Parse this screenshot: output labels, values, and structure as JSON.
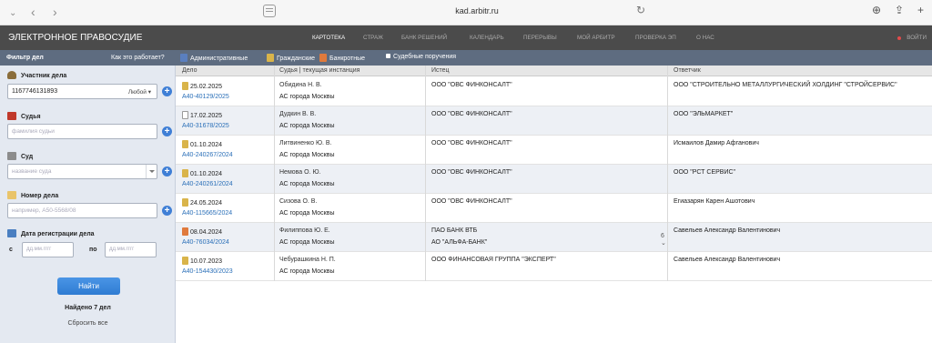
{
  "browser": {
    "url": "kad.arbitr.ru",
    "back_icon": "chevron-left-icon",
    "forward_icon": "chevron-right-icon"
  },
  "header": {
    "logo": "ЭЛЕКТРОННОЕ ПРАВОСУДИЕ",
    "nav": [
      {
        "label": "КАРТОТЕКА"
      },
      {
        "label": "СТРАЖ"
      },
      {
        "label": "БАНК РЕШЕНИЙ"
      },
      {
        "label": "КАЛЕНДАРЬ"
      },
      {
        "label": "ПЕРЕРЫВЫ"
      },
      {
        "label": "МОЙ АРБИТР"
      },
      {
        "label": "ПРОВЕРКА ЭП"
      },
      {
        "label": "О НАС"
      }
    ],
    "login": "ВОЙТИ"
  },
  "subheader": {
    "filter_title": "Фильтр дел",
    "how_it_works": "Как это работает?",
    "categories": [
      {
        "label": "Административные",
        "color": "#5a7fbf"
      },
      {
        "label": "Гражданские",
        "color": "#d9b44a"
      },
      {
        "label": "Банкротные",
        "color": "#e07a3c"
      },
      {
        "label": "Судебные поручения",
        "color": "#ffffff"
      }
    ]
  },
  "sidebar": {
    "participant_label": "Участник дела",
    "participant_value": "1167746131893",
    "participant_role": "Любой",
    "judge_label": "Судья",
    "judge_placeholder": "фамилия судьи",
    "court_label": "Суд",
    "court_placeholder": "название суда",
    "case_label": "Номер дела",
    "case_placeholder": "например, А50-5568/08",
    "date_label": "Дата регистрации дела",
    "date_from": "с",
    "date_to": "по",
    "date_placeholder": "дд.мм.гггг",
    "find_button": "Найти",
    "found_text": "Найдено 7 дел",
    "reset_text": "Сбросить все"
  },
  "table": {
    "headers": {
      "case": "Дело",
      "judge": "Судья | текущая инстанция",
      "plaintiff": "Истец",
      "respondent": "Ответчик"
    },
    "rows": [
      {
        "date": "25.02.2025",
        "number": "А40-40129/2025",
        "judge": "Обидина Н. В.",
        "court": "АС города Москвы",
        "plaintiff": "ООО \"ОВС ФИНКОНСАЛТ\"",
        "plaintiff2": "",
        "respondent": "ООО \"СТРОИТЕЛЬНО МЕТАЛЛУРГИЧЕСКИЙ ХОЛДИНГ \"СТРОЙСЕРВИС\"",
        "icon_color": "#d9b44a"
      },
      {
        "date": "17.02.2025",
        "number": "А40-31678/2025",
        "judge": "Дудкин В. В.",
        "court": "АС города Москвы",
        "plaintiff": "ООО \"ОВС ФИНКОНСАЛТ\"",
        "plaintiff2": "",
        "respondent": "ООО \"ЭЛЬМАРКЕТ\"",
        "icon_color": "#ffffff"
      },
      {
        "date": "01.10.2024",
        "number": "А40-240267/2024",
        "judge": "Литвиненко Ю. В.",
        "court": "АС города Москвы",
        "plaintiff": "ООО \"ОВС ФИНКОНСАЛТ\"",
        "plaintiff2": "",
        "respondent": "Исмаилов Дамир Афганович",
        "icon_color": "#d9b44a"
      },
      {
        "date": "01.10.2024",
        "number": "А40-240261/2024",
        "judge": "Немова О. Ю.",
        "court": "АС города Москвы",
        "plaintiff": "ООО \"ОВС ФИНКОНСАЛТ\"",
        "plaintiff2": "",
        "respondent": "ООО \"РСТ СЕРВИС\"",
        "icon_color": "#d9b44a"
      },
      {
        "date": "24.05.2024",
        "number": "А40-115665/2024",
        "judge": "Сизова О. В.",
        "court": "АС города Москвы",
        "plaintiff": "ООО \"ОВС ФИНКОНСАЛТ\"",
        "plaintiff2": "",
        "respondent": "Егиазарян Карен Ашотович",
        "icon_color": "#d9b44a"
      },
      {
        "date": "08.04.2024",
        "number": "А40-76034/2024",
        "judge": "Филиппова Ю. Е.",
        "court": "АС города Москвы",
        "plaintiff": "ПАО БАНК ВТБ",
        "plaintiff2": "АО \"АЛЬФА-БАНК\"",
        "respondent": "Савельев Александр Валентинович",
        "icon_color": "#e07a3c",
        "badge": "6"
      },
      {
        "date": "10.07.2023",
        "number": "А40-154430/2023",
        "judge": "Чебурашкина Н. П.",
        "court": "АС города Москвы",
        "plaintiff": "ООО ФИНАНСОВАЯ ГРУППА \"ЭКСПЕРТ\"",
        "plaintiff2": "",
        "respondent": "Савельев Александр Валентинович",
        "icon_color": "#d9b44a"
      }
    ]
  }
}
